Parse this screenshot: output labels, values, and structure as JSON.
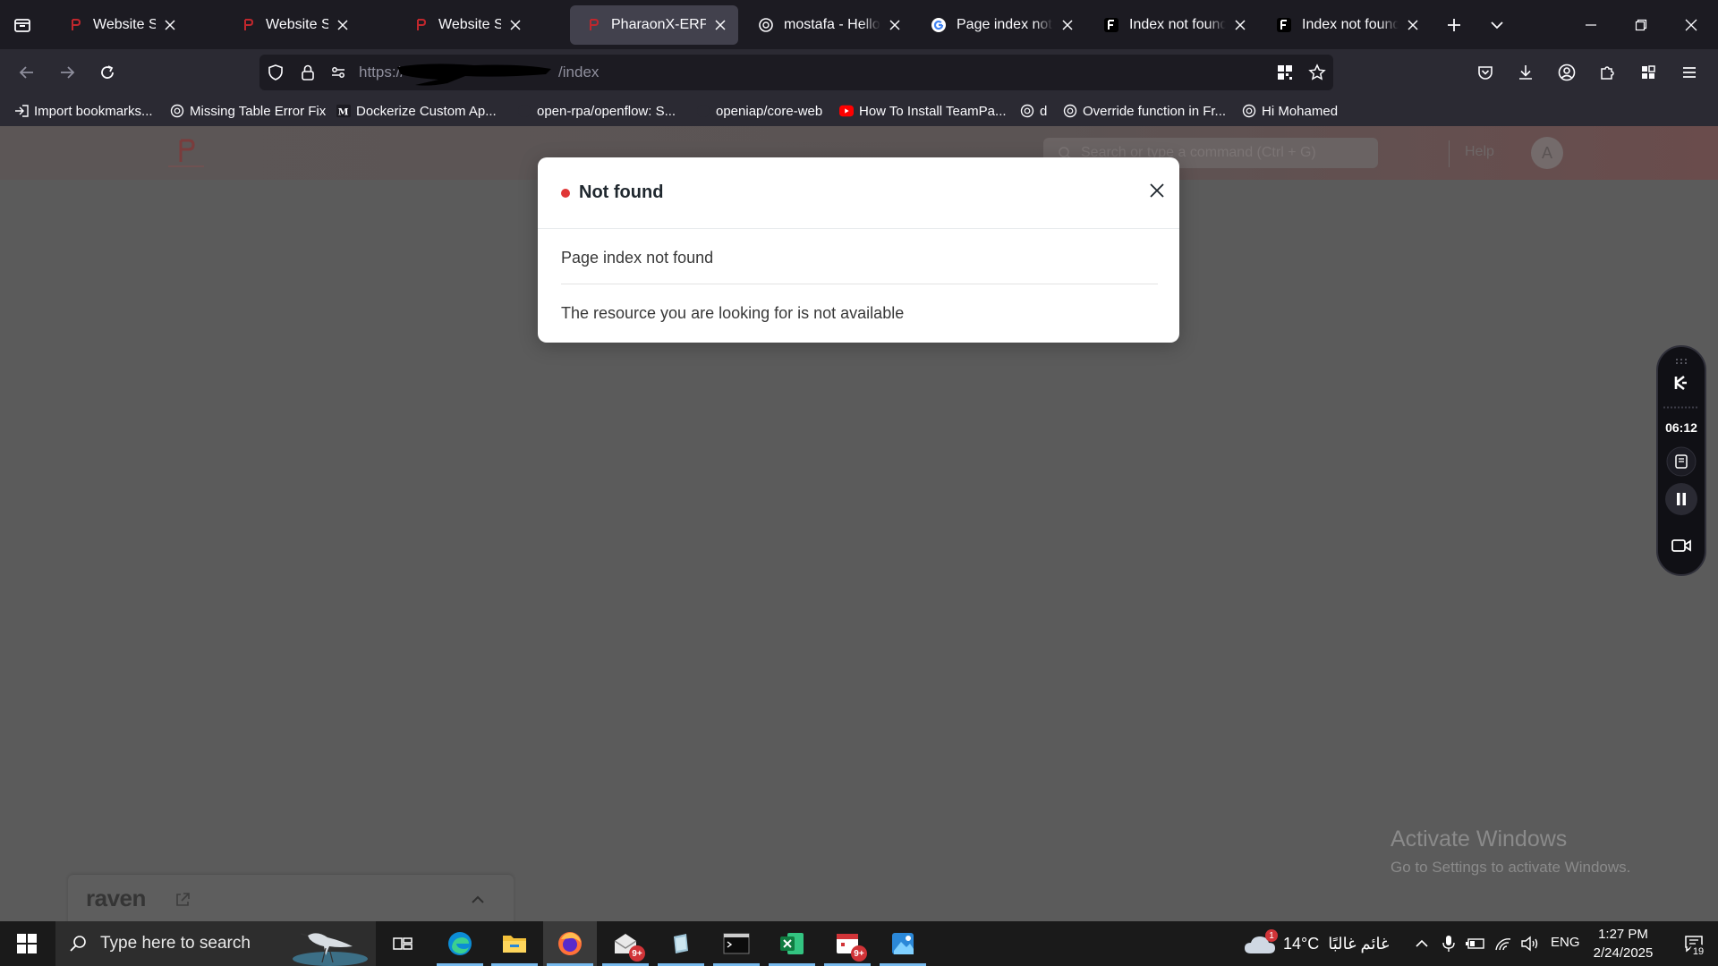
{
  "browser": {
    "tabs": [
      {
        "title": "Website Settings",
        "icon": "pharaonx-icon",
        "active": false
      },
      {
        "title": "Website Settings",
        "icon": "pharaonx-icon",
        "active": false
      },
      {
        "title": "Website Settings",
        "icon": "pharaonx-icon",
        "active": false
      },
      {
        "title": "PharaonX-ERP",
        "icon": "pharaonx-icon",
        "active": true
      },
      {
        "title": "mostafa - Hello as",
        "icon": "chatgpt-icon",
        "active": false
      },
      {
        "title": "Page index not fou",
        "icon": "google-icon",
        "active": false
      },
      {
        "title": "Index not found -",
        "icon": "frappe-icon",
        "active": false
      },
      {
        "title": "Index not found -",
        "icon": "frappe-icon",
        "active": false
      }
    ],
    "url": {
      "prefix": "https://",
      "suffix": "/index"
    },
    "bookmarks": [
      {
        "label": "Import bookmarks...",
        "icon": "import-icon"
      },
      {
        "label": "Missing Table Error Fix",
        "icon": "chatgpt-icon"
      },
      {
        "label": "Dockerize Custom Ap...",
        "icon": "medium-icon"
      },
      {
        "label": "open-rpa/openflow: S...",
        "icon": "github-icon"
      },
      {
        "label": "openiap/core-web",
        "icon": "github-icon"
      },
      {
        "label": "How To Install TeamPa...",
        "icon": "youtube-icon"
      },
      {
        "label": "d",
        "icon": "chatgpt-icon"
      },
      {
        "label": "Override function in Fr...",
        "icon": "chatgpt-icon"
      },
      {
        "label": "Hi Mohamed",
        "icon": "chatgpt-icon"
      }
    ]
  },
  "app": {
    "search_placeholder": "Search or type a command (Ctrl + G)",
    "help_label": "Help",
    "avatar_letter": "A"
  },
  "modal": {
    "title": "Not found",
    "message": "Page index not found",
    "detail": "The resource you are looking for is not available",
    "status_color": "#e03636"
  },
  "recorder": {
    "time": "06:12"
  },
  "watermark": {
    "title": "Activate Windows",
    "subtitle": "Go to Settings to activate Windows."
  },
  "raven": {
    "logo_text": "raven"
  },
  "taskbar": {
    "search_placeholder": "Type here to search",
    "weather_temp": "14°C",
    "weather_desc": "غائم غالبًا",
    "weather_alert_count": "1",
    "mail_badge": "9+",
    "outlook_badge": "9+",
    "language": "ENG",
    "time": "1:27 PM",
    "date": "2/24/2025",
    "notifications": "19"
  },
  "colors": {
    "tab_strip": "#1c1b22",
    "toolbar": "#2b2a33",
    "overlay": "#5b5b5b",
    "accent_red": "#e03636"
  }
}
